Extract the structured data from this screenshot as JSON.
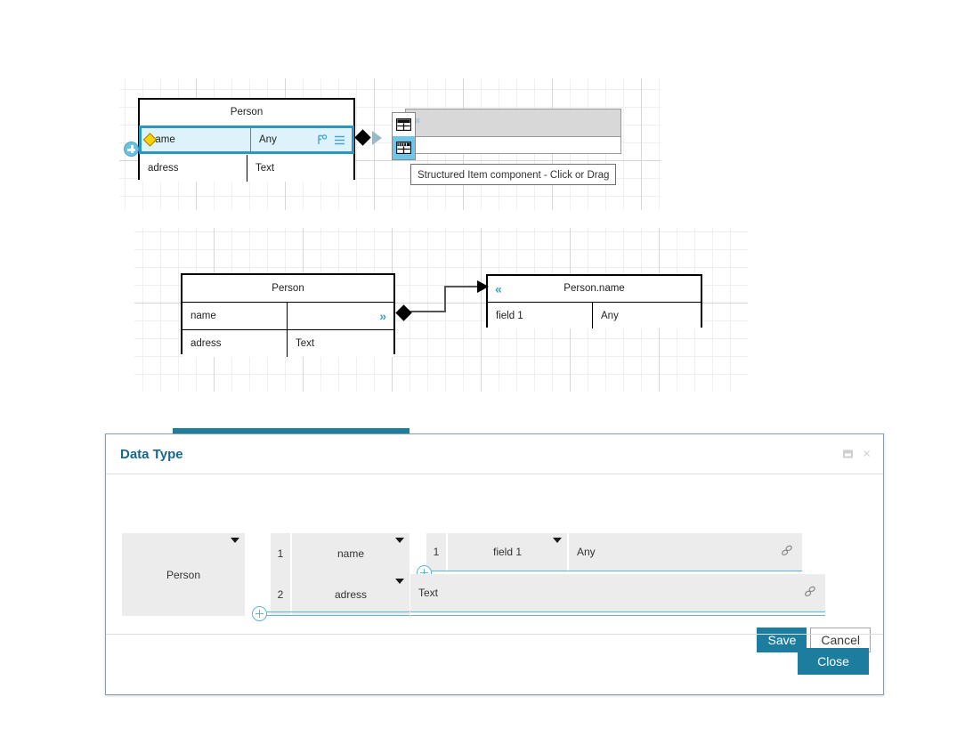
{
  "diagram_top": {
    "entity": {
      "title": "Person",
      "rows": [
        {
          "name": "name",
          "type": "Any",
          "selected": true,
          "icons": [
            "link-icon",
            "menu-icon"
          ]
        },
        {
          "name": "adress",
          "type": "Text",
          "selected": false,
          "icons": []
        }
      ]
    },
    "palette": {
      "items": [
        {
          "icon": "table-component-icon",
          "selected": false
        },
        {
          "icon": "structured-item-component-icon",
          "selected": true
        }
      ],
      "collapse_glyph": "«"
    },
    "tooltip": "Structured Item component - Click or Drag"
  },
  "diagram_bottom": {
    "source_entity": {
      "title": "Person",
      "rows": [
        {
          "name": "name",
          "type": "",
          "expand_glyph": "»"
        },
        {
          "name": "adress",
          "type": "Text",
          "expand_glyph": ""
        }
      ]
    },
    "target_entity": {
      "title": "Person.name",
      "collapse_glyph": "«",
      "rows": [
        {
          "name": "field 1",
          "type": "Any"
        }
      ]
    }
  },
  "dialog": {
    "title": "Data Type",
    "window_controls": [
      {
        "icon": "restore-icon",
        "label": ""
      },
      {
        "icon": "close-icon",
        "label": "×"
      }
    ],
    "type_selector": {
      "value": "Person"
    },
    "fields": [
      {
        "index": "1",
        "name": "name"
      },
      {
        "index": "2",
        "name": "adress"
      }
    ],
    "subfields": [
      {
        "index": "1",
        "name": "field 1",
        "type": "Any"
      }
    ],
    "adress_type": "Text",
    "buttons": {
      "save": "Save",
      "cancel": "Cancel",
      "close": "Close"
    },
    "colors": {
      "accent": "#1d7d9e",
      "title": "#18688a",
      "selection": "#2b97bd",
      "selection_fill": "#ddf2fb",
      "add_control": "#5bb6dd"
    }
  }
}
